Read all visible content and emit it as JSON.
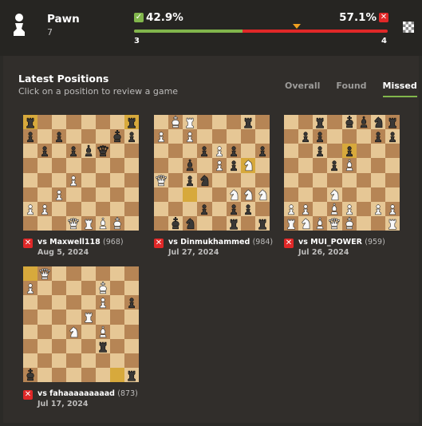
{
  "header": {
    "piece_name": "Pawn",
    "piece_count": "7",
    "found_pct": "42.9%",
    "missed_pct": "57.1%",
    "found_fraction": 0.429,
    "found_count": "3",
    "missed_count": "4",
    "found_color": "#81b64c",
    "missed_color": "#e02828"
  },
  "panel": {
    "title": "Latest Positions",
    "subtitle": "Click on a position to review a game",
    "tabs": [
      {
        "label": "Overall",
        "active": false
      },
      {
        "label": "Found",
        "active": false
      },
      {
        "label": "Missed",
        "active": true
      }
    ]
  },
  "board_colors": {
    "light": "#e6c795",
    "dark": "#b68555",
    "highlight": "#d7a93c"
  },
  "games": [
    {
      "opponent": "vs Maxwell118",
      "rating": "(968)",
      "date": "Aug 5, 2024",
      "result": "missed",
      "highlights": [
        "a8",
        "h8"
      ],
      "board": [
        "r......r",
        "p.p...kp",
        ".p.pbq..",
        "........",
        "...P....",
        "..P.....",
        "PP......",
        "...QRBK."
      ]
    },
    {
      "opponent": "vs Dinmukhammed",
      "rating": "(984)",
      "date": "Jul 27, 2024",
      "result": "missed",
      "highlights": [
        "c3",
        "g5"
      ],
      "board": [
        ".KR...r.",
        "P.P.....",
        "...pPp.p",
        "..b.PpN.",
        "Q.pn....",
        ".....NNN",
        "...p.pp.",
        ".kn..r.r"
      ]
    },
    {
      "opponent": "vs MUI_POWER",
      "rating": "(959)",
      "date": "Jul 26, 2024",
      "result": "missed",
      "highlights": [
        "e6"
      ],
      "board": [
        "..r.kbnr",
        ".pp...pp",
        "..p.p...",
        "...pB...",
        "........",
        "...N....",
        "PP.BP.PP",
        "RNBQK..R"
      ]
    },
    {
      "opponent": "vs fahaaaaaaaaad",
      "rating": "(873)",
      "date": "Jul 17, 2024",
      "result": "missed",
      "highlights": [
        "g1",
        "a8"
      ],
      "board": [
        ".Q......",
        "P....K..",
        ".....P.p",
        "....R...",
        "...N.B..",
        ".....r..",
        "........",
        "k......r"
      ]
    }
  ]
}
